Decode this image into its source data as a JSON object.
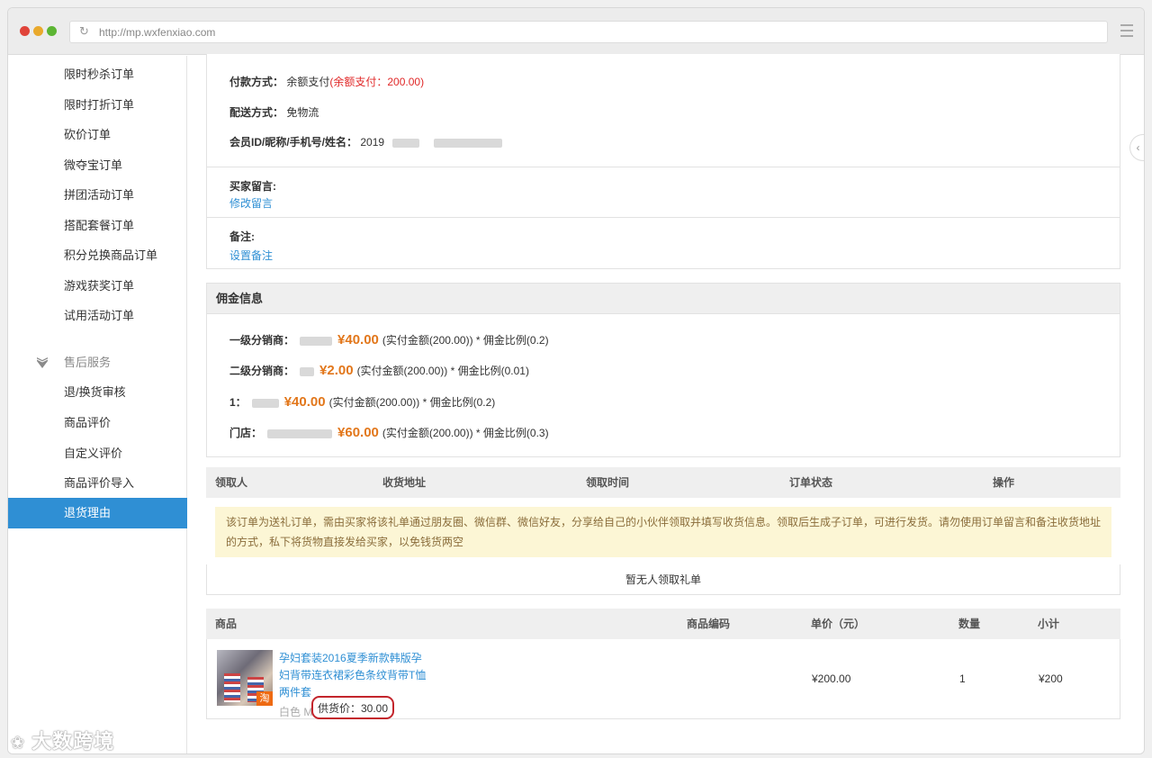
{
  "browser": {
    "url": "http://mp.wxfenxiao.com"
  },
  "sidebar": {
    "items": [
      {
        "label": "限时秒杀订单"
      },
      {
        "label": "限时打折订单"
      },
      {
        "label": "砍价订单"
      },
      {
        "label": "微夺宝订单"
      },
      {
        "label": "拼团活动订单"
      },
      {
        "label": "搭配套餐订单"
      },
      {
        "label": "积分兑换商品订单"
      },
      {
        "label": "游戏获奖订单"
      },
      {
        "label": "试用活动订单"
      }
    ],
    "group": {
      "label": "售后服务",
      "icon": "shield-icon"
    },
    "after_items": [
      {
        "label": "退/换货审核"
      },
      {
        "label": "商品评价"
      },
      {
        "label": "自定义评价"
      },
      {
        "label": "商品评价导入"
      },
      {
        "label": "退货理由",
        "active": true
      }
    ]
  },
  "order_info": {
    "payment_label": "付款方式：",
    "payment_value": "余额支付",
    "payment_detail": "(余额支付：200.00)",
    "shipping_label": "配送方式：",
    "shipping_value": "免物流",
    "member_label": "会员ID/昵称/手机号/姓名：",
    "member_id": "2019"
  },
  "buyer_message": {
    "label": "买家留言:",
    "action": "修改留言"
  },
  "remark": {
    "label": "备注:",
    "action": "设置备注"
  },
  "commission": {
    "title": "佣金信息",
    "rows": [
      {
        "label": "一级分销商：",
        "amount": "¥40.00",
        "formula": "(实付金额(200.00)) * 佣金比例(0.2)"
      },
      {
        "label": "二级分销商：",
        "amount": "¥2.00",
        "formula": "(实付金额(200.00)) * 佣金比例(0.01)"
      },
      {
        "label": "1：",
        "amount": "¥40.00",
        "formula": "(实付金额(200.00)) * 佣金比例(0.2)"
      },
      {
        "label": "门店：",
        "amount": "¥60.00",
        "formula": "(实付金额(200.00)) * 佣金比例(0.3)"
      }
    ]
  },
  "gift_table": {
    "headers": [
      "领取人",
      "收货地址",
      "领取时间",
      "订单状态",
      "操作"
    ],
    "notice": "该订单为送礼订单，需由买家将该礼单通过朋友圈、微信群、微信好友，分享给自己的小伙伴领取并填写收货信息。领取后生成子订单，可进行发货。请勿使用订单留言和备注收货地址的方式，私下将货物直接发给买家，以免钱货两空",
    "empty": "暂无人领取礼单"
  },
  "product_table": {
    "headers": [
      "商品",
      "商品编码",
      "单价（元）",
      "数量",
      "小计"
    ],
    "rows": [
      {
        "title": "孕妇套装2016夏季新款韩版孕妇背带连衣裙彩色条纹背带T恤两件套",
        "spec": "白色 M",
        "supply_price": "供货价：30.00",
        "code": "",
        "unit_price": "¥200.00",
        "qty": "1",
        "subtotal": "¥200"
      }
    ]
  },
  "watermark": "大数跨境"
}
